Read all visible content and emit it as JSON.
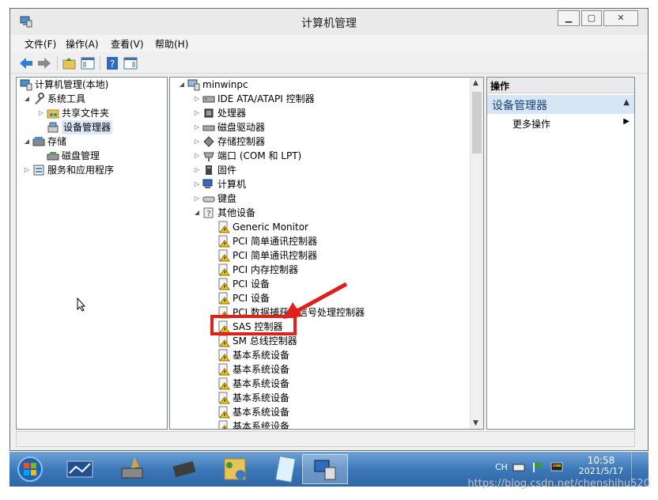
{
  "window": {
    "title": "计算机管理"
  },
  "menu": [
    "文件(F)",
    "操作(A)",
    "查看(V)",
    "帮助(H)"
  ],
  "left_tree": [
    {
      "label": "计算机管理(本地)",
      "expander": ""
    },
    {
      "label": "系统工具",
      "expander": "◢"
    },
    {
      "label": "共享文件夹",
      "expander": "▷"
    },
    {
      "label": "设备管理器",
      "expander": ""
    },
    {
      "label": "存储",
      "expander": "◢"
    },
    {
      "label": "磁盘管理",
      "expander": ""
    },
    {
      "label": "服务和应用程序",
      "expander": "▷"
    }
  ],
  "device_tree": {
    "root": "minwinpc",
    "categories": [
      "IDE ATA/ATAPI 控制器",
      "处理器",
      "磁盘驱动器",
      "存储控制器",
      "端口 (COM 和 LPT)",
      "固件",
      "计算机",
      "键盘",
      "其他设备"
    ],
    "other_devices": [
      "Generic Monitor",
      "PCI 简单通讯控制器",
      "PCI 简单通讯控制器",
      "PCI 内存控制器",
      "PCI 设备",
      "PCI 设备",
      "PCI 数据捕获和信号处理控制器",
      "SAS 控制器",
      "SM 总线控制器",
      "基本系统设备",
      "基本系统设备",
      "基本系统设备",
      "基本系统设备",
      "基本系统设备",
      "基本系统设备"
    ]
  },
  "actions": {
    "header": "操作",
    "section": "设备管理器",
    "more": "更多操作"
  },
  "taskbar": {
    "lang": "CH",
    "time": "10:58",
    "date": "2021/5/17"
  },
  "watermark": "https://blog.csdn.net/chenshihu520",
  "colors": {
    "highlight_box": "#e0201c",
    "taskbar": "#3c78b8",
    "selection": "#dbe9f8"
  }
}
